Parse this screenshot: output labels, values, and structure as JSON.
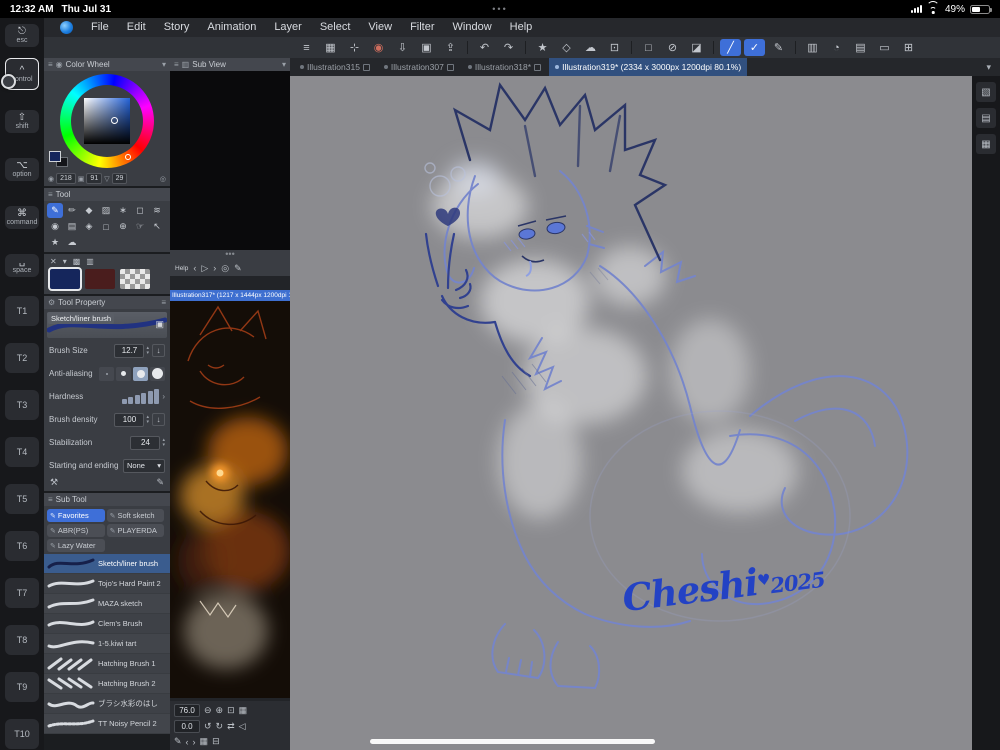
{
  "status_bar": {
    "time": "12:32 AM",
    "date": "Thu Jul 31",
    "menu_dots": "•••",
    "battery": "49%"
  },
  "glyphs": {
    "menu": "≡",
    "caret": "▾",
    "up": "▴",
    "down": "▾",
    "left": "‹",
    "right": "›",
    "undo": "↺",
    "redo": "↻",
    "play": "▷",
    "pencil": "✎",
    "grid": "▦",
    "trash": "⊟",
    "wrench": "⚒",
    "folder": "▣",
    "download": "↓",
    "eyedropper": "◎",
    "fit": "⊡",
    "zoom_in": "⊕",
    "zoom_out": "⊖",
    "flip": "⇄",
    "flipv": "◁",
    "target": "◎",
    "x": "✕",
    "set1": "▩",
    "set2": "▥",
    "hue": "◉",
    "sat": "▣",
    "val": "▽",
    "gear": "⚙",
    "material": "▧",
    "layers": "▤",
    "gridpanel": "▦"
  },
  "edge": {
    "keys": [
      {
        "label": "esc",
        "glyph": "⎋"
      },
      {
        "label": "control",
        "glyph": "^"
      },
      {
        "label": "shift",
        "glyph": "⇧"
      },
      {
        "label": "option",
        "glyph": "⌥"
      },
      {
        "label": "command",
        "glyph": "⌘"
      },
      {
        "label": "space",
        "glyph": "␣"
      }
    ],
    "tkeys": [
      "T1",
      "T2",
      "T3",
      "T4",
      "T5",
      "T6",
      "T7",
      "T8",
      "T9",
      "T10"
    ]
  },
  "menu": {
    "items": [
      "File",
      "Edit",
      "Story",
      "Animation",
      "Layer",
      "Select",
      "View",
      "Filter",
      "Window",
      "Help"
    ]
  },
  "toolbar": {
    "icons": [
      {
        "n": "main-menu",
        "g": "≡"
      },
      {
        "n": "canvas-grid",
        "g": "▦"
      },
      {
        "n": "transform",
        "g": "⊹"
      },
      {
        "n": "record",
        "g": "◉"
      },
      {
        "n": "import",
        "g": "⇩"
      },
      {
        "n": "manage-files",
        "g": "▣"
      },
      {
        "n": "export",
        "g": "⇪"
      },
      {
        "n": "undo",
        "g": "↶"
      },
      {
        "n": "redo",
        "g": "↷"
      },
      {
        "n": "auto-action",
        "g": "★"
      },
      {
        "n": "clear",
        "g": "◇"
      },
      {
        "n": "cloud",
        "g": "☁"
      },
      {
        "n": "crop",
        "g": "⊡"
      },
      {
        "n": "select-area",
        "g": "□"
      },
      {
        "n": "deselect",
        "g": "⊘"
      },
      {
        "n": "invert-selection",
        "g": "◪"
      },
      {
        "n": "snap-ruler",
        "g": "╱"
      },
      {
        "n": "snap-special-ruler",
        "g": "✓"
      },
      {
        "n": "pen-settings",
        "g": "✎"
      },
      {
        "n": "material",
        "g": "▥"
      },
      {
        "n": "timelapse",
        "g": "◔"
      },
      {
        "n": "palette",
        "g": "▤"
      },
      {
        "n": "window-mode",
        "g": "▭"
      },
      {
        "n": "maximize",
        "g": "⊞"
      }
    ]
  },
  "tabs": {
    "items": [
      {
        "label": "Illustration315"
      },
      {
        "label": "Illustration307"
      },
      {
        "label": "Illustration318*"
      },
      {
        "label": "Illustration319* (2334 x 3000px 1200dpi 80.1%)"
      }
    ]
  },
  "color_wheel": {
    "title": "Color Wheel",
    "h": "218",
    "s": "91",
    "v": "29"
  },
  "tool": {
    "title": "Tool",
    "tools": [
      {
        "n": "pen",
        "g": "✎"
      },
      {
        "n": "pencil",
        "g": "✏"
      },
      {
        "n": "marker",
        "g": "◆"
      },
      {
        "n": "airbrush",
        "g": "▨"
      },
      {
        "n": "decoration",
        "g": "∗"
      },
      {
        "n": "eraser",
        "g": "◻"
      },
      {
        "n": "blend",
        "g": "≋"
      },
      {
        "n": "fill",
        "g": "◉"
      },
      {
        "n": "gradient",
        "g": "▤"
      },
      {
        "n": "figure",
        "g": "◈"
      },
      {
        "n": "selection",
        "g": "□"
      },
      {
        "n": "zoom",
        "g": "⊕"
      },
      {
        "n": "hand",
        "g": "☞"
      },
      {
        "n": "move",
        "g": "↖"
      },
      {
        "n": "correction",
        "g": "★"
      },
      {
        "n": "cloud-brush",
        "g": "☁"
      }
    ]
  },
  "tool_property": {
    "title": "Tool Property",
    "brush_name": "Sketch/liner brush",
    "brush_size_label": "Brush Size",
    "brush_size": "12.7",
    "aa_label": "Anti-aliasing",
    "hardness_label": "Hardness",
    "density_label": "Brush density",
    "density": "100",
    "stabilization_label": "Stabilization",
    "stabilization": "24",
    "start_end_label": "Starting and ending",
    "start_end_value": "None"
  },
  "sub_tool": {
    "title": "Sub Tool",
    "tabs": [
      {
        "label": "Favorites"
      },
      {
        "label": "Soft sketch"
      },
      {
        "label": "ABR(PS)"
      },
      {
        "label": "PLAYERDA"
      },
      {
        "label": "Lazy Water"
      }
    ],
    "brushes": [
      {
        "name": "Sketch/liner brush"
      },
      {
        "name": "Tojo's Hard Paint 2"
      },
      {
        "name": "MAZA sketch"
      },
      {
        "name": "Clem's Brush"
      },
      {
        "name": "1-5.kiwi tart"
      },
      {
        "name": "Hatching Brush 1"
      },
      {
        "name": "Hatching Brush 2"
      },
      {
        "name": "ブラシ水彩のはし"
      },
      {
        "name": "TT Noisy Pencil 2"
      }
    ]
  },
  "sub_view": {
    "title": "Sub View",
    "menu_dots": "•••",
    "help": "Help",
    "file_info": "Illustration317* (1217 x 1444px 1200dpi 12"
  },
  "navigator": {
    "zoom": "76.0",
    "rotation": "0.0"
  },
  "canvas": {
    "signature": "Cheshi",
    "heart": "♥",
    "year": "2025",
    "background": "#8b8b8f",
    "accent_blue": "#3e6fd8"
  }
}
